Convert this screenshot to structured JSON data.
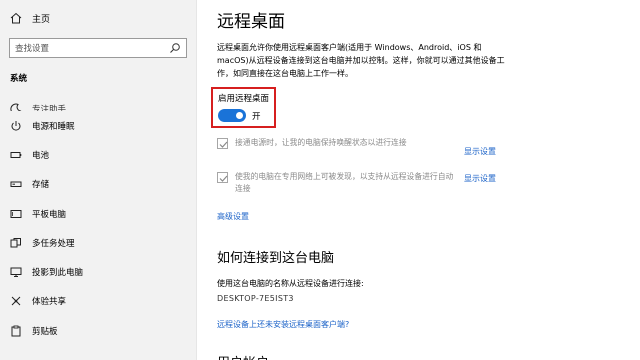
{
  "sidebar": {
    "home_label": "主页",
    "search_placeholder": "查找设置",
    "section_title": "系统",
    "items": [
      {
        "label": "专注助手",
        "icon": "moon-icon"
      },
      {
        "label": "电源和睡眠",
        "icon": "power-icon"
      },
      {
        "label": "电池",
        "icon": "battery-icon"
      },
      {
        "label": "存储",
        "icon": "storage-icon"
      },
      {
        "label": "平板电脑",
        "icon": "tablet-icon"
      },
      {
        "label": "多任务处理",
        "icon": "multitask-icon"
      },
      {
        "label": "投影到此电脑",
        "icon": "project-icon"
      },
      {
        "label": "体验共享",
        "icon": "share-icon"
      },
      {
        "label": "剪贴板",
        "icon": "clipboard-icon"
      }
    ]
  },
  "main": {
    "title": "远程桌面",
    "description": "远程桌面允许你使用远程桌面客户端(适用于 Windows、Android、iOS 和 macOS)从远程设备连接到这台电脑并加以控制。这样，你就可以通过其他设备工作，如同直接在这台电脑上工作一样。",
    "toggle": {
      "label": "启用远程桌面",
      "state": "开",
      "on": true
    },
    "options": [
      {
        "text": "接通电源时，让我的电脑保持唤醒状态以进行连接",
        "checked": true,
        "link": "显示设置"
      },
      {
        "text": "使我的电脑在专用网络上可被发现，以支持从远程设备进行自动连接",
        "checked": true,
        "link": "显示设置"
      }
    ],
    "advanced_link": "高级设置",
    "connect_heading": "如何连接到这台电脑",
    "connect_desc": "使用这台电脑的名称从远程设备进行连接:",
    "pc_name": "DESKTOP-7E5IST3",
    "client_link": "远程设备上还未安装远程桌面客户端?",
    "next_heading": "用户帐户"
  },
  "colors": {
    "accent": "#1a73d8",
    "link": "#1c63c8",
    "highlight_box": "#d61f1f",
    "sidebar_bg": "#f2f2f2"
  }
}
